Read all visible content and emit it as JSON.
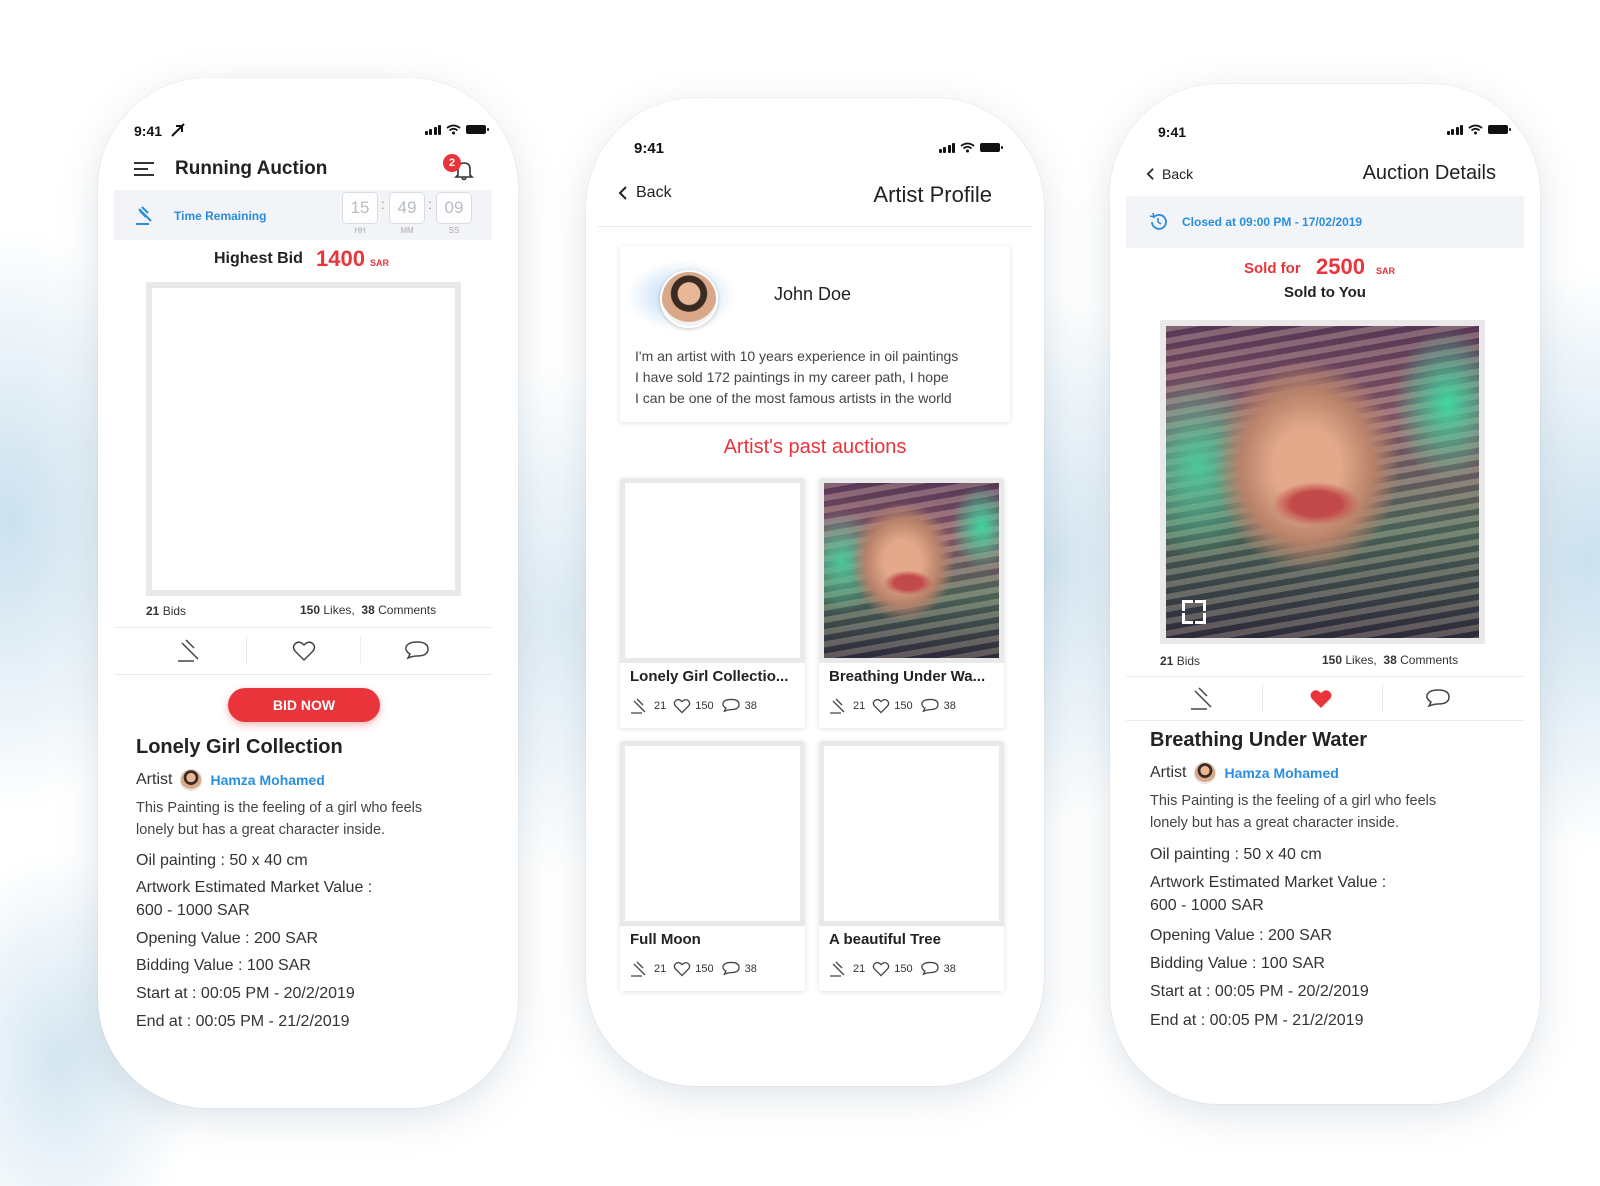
{
  "phone1": {
    "status_time": "9:41",
    "title": "Running Auction",
    "notification_count": "2",
    "time_remaining_label": "Time Remaining",
    "timer": {
      "hh": "15",
      "mm": "49",
      "ss": "09",
      "hh_label": "HH",
      "mm_label": "MM",
      "ss_label": "SS"
    },
    "highest_bid_label": "Highest Bid",
    "highest_bid_value": "1400",
    "currency": "SAR",
    "bids": "21",
    "bids_label": "Bids",
    "likes": "150",
    "likes_label": "Likes,",
    "comments": "38",
    "comments_label": "Comments",
    "bid_button": "BID NOW",
    "artwork_title": "Lonely Girl Collection",
    "artist_label": "Artist",
    "artist_name": "Hamza Mohamed",
    "description_1": "This Painting is the feeling of a girl who feels",
    "description_2": "lonely but has a great character inside.",
    "oil_painting": "Oil painting : 50 x 40 cm",
    "market_value_label": "Artwork Estimated Market Value :",
    "market_value": "600 - 1000 SAR",
    "opening_value": "Opening Value : 200 SAR",
    "bidding_value": "Bidding Value : 100 SAR",
    "start_at": "Start at : 00:05 PM - 20/2/2019",
    "end_at": "End at : 00:05 PM - 21/2/2019"
  },
  "phone2": {
    "status_time": "9:41",
    "back_label": "Back",
    "title": "Artist Profile",
    "artist_name": "John Doe",
    "bio_1": "I'm an artist with 10 years experience in oil paintings",
    "bio_2": "I have sold 172 paintings in my career path, I hope",
    "bio_3": "I can be one of the most famous artists in the world",
    "past_auctions_title": "Artist's past auctions",
    "auctions": [
      {
        "title": "Lonely Girl Collectio...",
        "bids": "21",
        "likes": "150",
        "comments": "38"
      },
      {
        "title": "Breathing Under Wa...",
        "bids": "21",
        "likes": "150",
        "comments": "38"
      },
      {
        "title": "Full Moon",
        "bids": "21",
        "likes": "150",
        "comments": "38"
      },
      {
        "title": "A beautiful Tree",
        "bids": "21",
        "likes": "150",
        "comments": "38"
      }
    ]
  },
  "phone3": {
    "status_time": "9:41",
    "back_label": "Back",
    "title": "Auction Details",
    "closed_at": "Closed at 09:00 PM - 17/02/2019",
    "sold_for_label": "Sold for",
    "sold_for_value": "2500",
    "currency": "SAR",
    "sold_to": "Sold to You",
    "bids": "21",
    "bids_label": "Bids",
    "likes": "150",
    "likes_label": "Likes,",
    "comments": "38",
    "comments_label": "Comments",
    "artwork_title": "Breathing Under Water",
    "artist_label": "Artist",
    "artist_name": "Hamza Mohamed",
    "description_1": "This Painting is the feeling of a girl who feels",
    "description_2": "lonely but has a great character inside.",
    "oil_painting": "Oil painting : 50 x 40 cm",
    "market_value_label": "Artwork Estimated Market Value :",
    "market_value": "600 - 1000 SAR",
    "opening_value": "Opening Value : 200 SAR",
    "bidding_value": "Bidding Value : 100 SAR",
    "start_at": "Start at : 00:05 PM - 20/2/2019",
    "end_at": "End at : 00:05 PM - 21/2/2019"
  },
  "colors": {
    "accent_red": "#e8343a",
    "link_blue": "#2a8ee0"
  },
  "icons": [
    "menu-icon",
    "bell-icon",
    "gavel-icon",
    "heart-icon",
    "comment-icon",
    "expand-icon",
    "back-chevron-icon",
    "history-icon",
    "signal-icon",
    "wifi-icon",
    "battery-icon"
  ]
}
